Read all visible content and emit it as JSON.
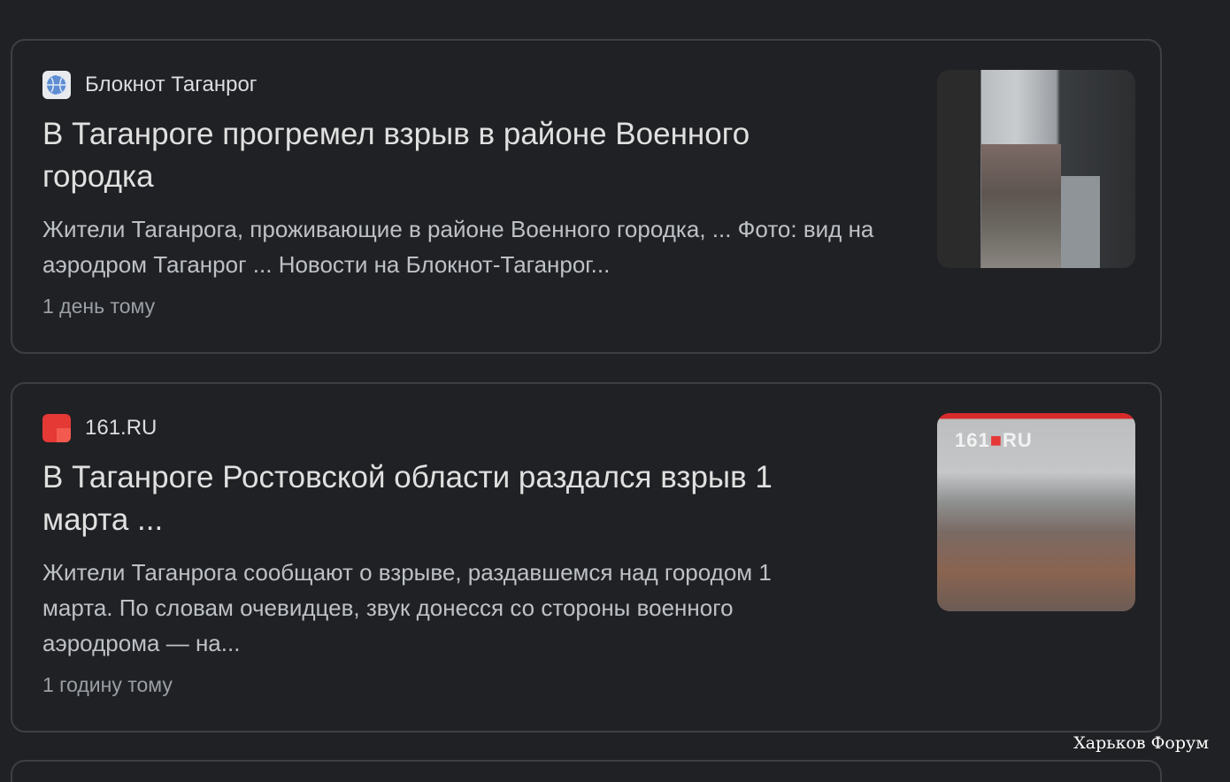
{
  "results": [
    {
      "source": "Блокнот Таганрог",
      "title": "В Таганроге прогремел взрыв в районе Военного городка",
      "snippet": "Жители Таганрога, проживающие в районе Военного городка, ... Фото: вид на аэродром Таганрог ... Новости на Блокнот-Таганрог...",
      "time": "1 день тому",
      "icon": "globe-icon"
    },
    {
      "source": "161.RU",
      "title": "В Таганроге Ростовской области раздался взрыв 1 марта ...",
      "snippet": "Жители Таганрога сообщают о взрыве, раздавшемся над городом 1 марта. По словам очевидцев, звук донесся со стороны военного аэродрома — на...",
      "time": "1 годину тому",
      "icon": "red-square-icon",
      "thumb_logo": "161",
      "thumb_logo_suffix": "RU"
    }
  ],
  "watermark": "Харьков Форум",
  "colors": {
    "background": "#202124",
    "card_border": "#3c4043",
    "title": "#e0e0e0",
    "snippet": "#bdc1c6",
    "time": "#9aa0a6"
  }
}
